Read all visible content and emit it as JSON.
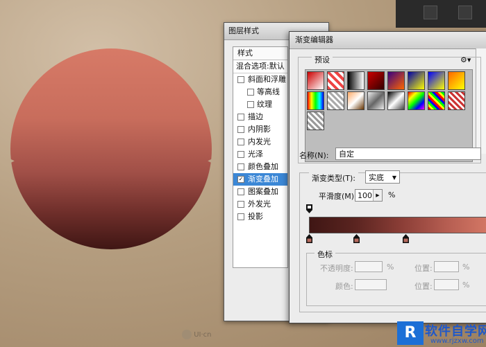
{
  "layer_style": {
    "title": "图层样式",
    "list_header": "样式",
    "blend_row": "混合选项:默认",
    "items": [
      {
        "label": "斜面和浮雕",
        "sub": false,
        "checked": false
      },
      {
        "label": "等高线",
        "sub": true,
        "checked": false
      },
      {
        "label": "纹理",
        "sub": true,
        "checked": false
      },
      {
        "label": "描边",
        "sub": false,
        "checked": false
      },
      {
        "label": "内阴影",
        "sub": false,
        "checked": false
      },
      {
        "label": "内发光",
        "sub": false,
        "checked": false
      },
      {
        "label": "光泽",
        "sub": false,
        "checked": false
      },
      {
        "label": "颜色叠加",
        "sub": false,
        "checked": false
      },
      {
        "label": "渐变叠加",
        "sub": false,
        "checked": true,
        "selected": true
      },
      {
        "label": "图案叠加",
        "sub": false,
        "checked": false
      },
      {
        "label": "外发光",
        "sub": false,
        "checked": false
      },
      {
        "label": "投影",
        "sub": false,
        "checked": false
      }
    ]
  },
  "gradient_editor": {
    "title": "渐变编辑器",
    "presets_label": "预设",
    "gear_icon": "gear-icon",
    "name_label": "名称(N):",
    "name_value": "自定",
    "type_label": "渐变类型(T):",
    "type_value": "实底",
    "smoothness_label": "平滑度(M):",
    "smoothness_value": "100",
    "smoothness_unit": "%",
    "stops_label": "色标",
    "opacity_label": "不透明度:",
    "opacity_unit": "%",
    "position_label": "位置:",
    "position_unit": "%",
    "color_label": "颜色:",
    "position_label_2": "位置:",
    "position_unit_2": "%",
    "gradient_colors": [
      "#3f1614",
      "#5a2420",
      "#8a3d36",
      "#b55d51",
      "#d77a67"
    ],
    "color_stops_percent": [
      0,
      26,
      53
    ],
    "opacity_stops_percent": [
      0
    ]
  },
  "watermarks": {
    "left": "UI·cn",
    "right_logo": "R",
    "right_text": "软件自学网",
    "right_url": "www.rjzxw.com"
  }
}
